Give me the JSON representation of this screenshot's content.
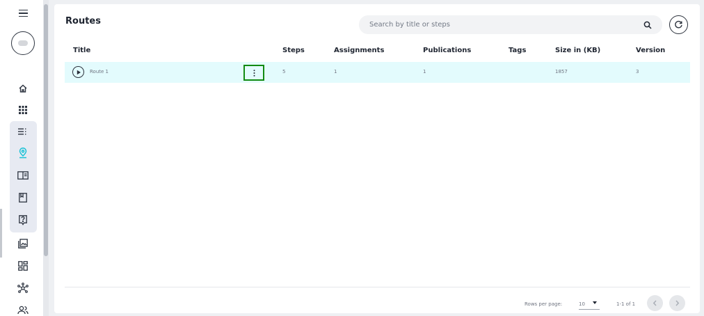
{
  "page": {
    "title": "Routes"
  },
  "search": {
    "placeholder": "Search by title or steps"
  },
  "table": {
    "columns": [
      "Title",
      "Steps",
      "Assignments",
      "Publications",
      "Tags",
      "Size in (KB)",
      "Version"
    ],
    "rows": [
      {
        "title": "Route 1",
        "steps": "5",
        "assignments": "1",
        "publications": "1",
        "tags": "",
        "size": "1857",
        "version": "3"
      }
    ]
  },
  "footer": {
    "rows_per_page_label": "Rows per page:",
    "rows_per_page_value": "10",
    "range": "1-1 of 1"
  },
  "sidebar": {
    "items": [
      "home-icon",
      "apps-grid-icon",
      "list-icon",
      "route-pin-icon",
      "panel-icon",
      "bookmark-book-icon",
      "help-icon",
      "gallery-icon",
      "dashboard-icon",
      "network-icon",
      "users-icon"
    ]
  },
  "colors": {
    "accent": "#19c2d6",
    "row_highlight": "#e3fbfd",
    "kebab_outline": "#128a12"
  }
}
